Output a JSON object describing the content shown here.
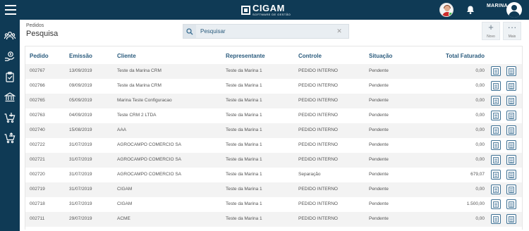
{
  "app": {
    "logo_main": "CIGAM",
    "logo_sub": "SOFTWARE DE GESTÃO",
    "user_name": "MARINA"
  },
  "header": {
    "breadcrumb": "Pedidos",
    "title": "Pesquisa",
    "search_placeholder": "Pesquisar",
    "novo_label": "Novo",
    "mais_label": "Mais"
  },
  "table": {
    "columns": [
      "Pedido",
      "Emissão",
      "Cliente",
      "Representante",
      "Controle",
      "Situação",
      "Total Faturado"
    ],
    "rows": [
      {
        "pedido": "002767",
        "emissao": "13/09/2019",
        "cliente": "Teste da Marina CRM",
        "representante": "Teste da Marina 1",
        "controle": "PEDIDO INTERNO",
        "situacao": "Pendente",
        "total": "0,00"
      },
      {
        "pedido": "002766",
        "emissao": "09/09/2019",
        "cliente": "Teste da Marina CRM",
        "representante": "Teste da Marina 1",
        "controle": "PEDIDO INTERNO",
        "situacao": "Pendente",
        "total": "0,00"
      },
      {
        "pedido": "002765",
        "emissao": "05/09/2019",
        "cliente": "Marina Teste Configuracao",
        "representante": "Teste da Marina 1",
        "controle": "PEDIDO INTERNO",
        "situacao": "Pendente",
        "total": "0,00"
      },
      {
        "pedido": "002763",
        "emissao": "04/09/2019",
        "cliente": "Teste CRM 2 LTDA",
        "representante": "Teste da Marina 1",
        "controle": "PEDIDO INTERNO",
        "situacao": "Pendente",
        "total": "0,00"
      },
      {
        "pedido": "002740",
        "emissao": "15/08/2019",
        "cliente": "AAA",
        "representante": "Teste da Marina 1",
        "controle": "PEDIDO INTERNO",
        "situacao": "Pendente",
        "total": "0,00"
      },
      {
        "pedido": "002722",
        "emissao": "31/07/2019",
        "cliente": "AGROCAMPO COMERCIO SA",
        "representante": "Teste da Marina 1",
        "controle": "PEDIDO INTERNO",
        "situacao": "Pendente",
        "total": "0,00"
      },
      {
        "pedido": "002721",
        "emissao": "31/07/2019",
        "cliente": "AGROCAMPO COMERCIO SA",
        "representante": "Teste da Marina 1",
        "controle": "PEDIDO INTERNO",
        "situacao": "Pendente",
        "total": "0,00"
      },
      {
        "pedido": "002720",
        "emissao": "31/07/2019",
        "cliente": "AGROCAMPO COMERCIO SA",
        "representante": "Teste da Marina 1",
        "controle": "Separação",
        "situacao": "Pendente",
        "total": "679,07"
      },
      {
        "pedido": "002719",
        "emissao": "31/07/2019",
        "cliente": "CIGAM",
        "representante": "Teste da Marina 1",
        "controle": "PEDIDO INTERNO",
        "situacao": "Pendente",
        "total": "0,00"
      },
      {
        "pedido": "002718",
        "emissao": "31/07/2019",
        "cliente": "CIGAM",
        "representante": "Teste da Marina 1",
        "controle": "PEDIDO INTERNO",
        "situacao": "Pendente",
        "total": "1.500,00"
      },
      {
        "pedido": "002711",
        "emissao": "29/07/2019",
        "cliente": "ACME",
        "representante": "Teste da Marina 1",
        "controle": "PEDIDO INTERNO",
        "situacao": "Pendente",
        "total": "0,00"
      }
    ]
  },
  "icons": {
    "sidebar": [
      "users-icon",
      "hand-money-icon",
      "clipboard-icon",
      "bank-icon",
      "cart-download-icon",
      "cart-upload-icon"
    ],
    "row_actions": [
      "document-icon",
      "list-icon"
    ]
  },
  "colors": {
    "primary": "#0f3a55",
    "header_text": "#2a5b7d",
    "row_alt": "#f3f3f3"
  }
}
